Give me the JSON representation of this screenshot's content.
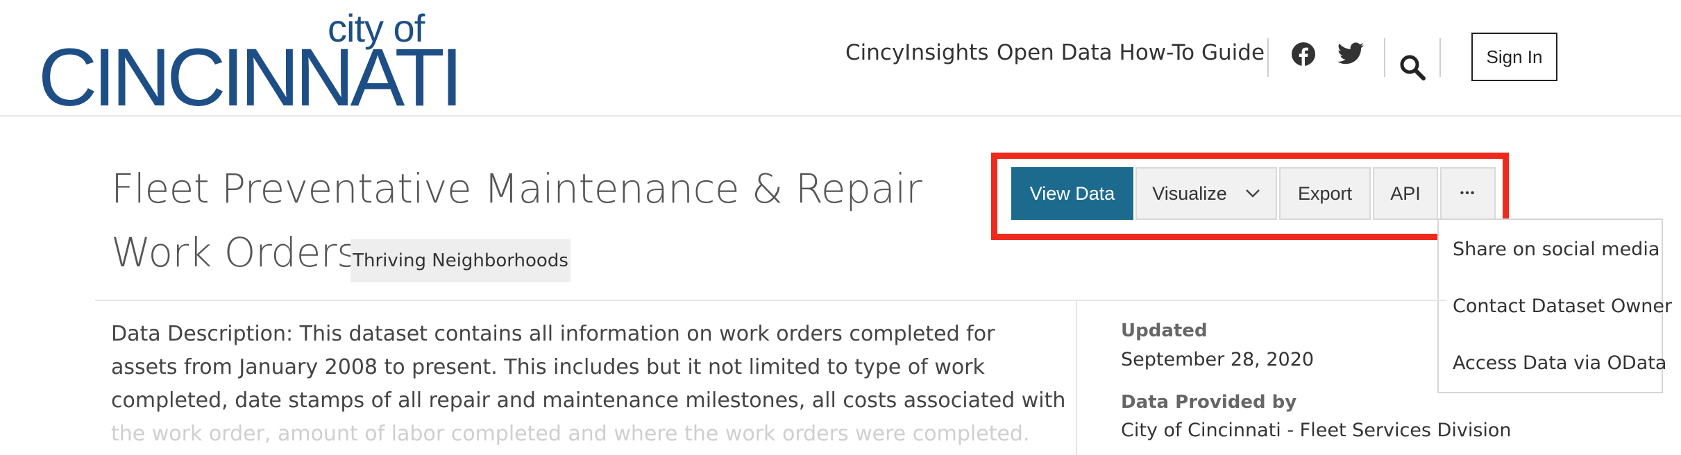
{
  "header": {
    "logo_small": "city of",
    "logo_big": "CINCINNATI",
    "nav": [
      "CincyInsights",
      "Open Data How-To Guide"
    ],
    "sign_in": "Sign In",
    "icons": [
      "facebook-icon",
      "twitter-icon",
      "search-icon"
    ],
    "brand_color": "#1d4e86"
  },
  "dataset": {
    "title": "Fleet Preventative Maintenance & Repair Work Orders",
    "tag": "Thriving Neighborhoods"
  },
  "toolbar": {
    "view_data": "View Data",
    "visualize": "Visualize",
    "export": "Export",
    "api": "API",
    "more": "•••",
    "primary_color": "#1d6a8f",
    "highlight_color": "#ee2a1c"
  },
  "more_menu": {
    "items": [
      "Share on social media",
      "Contact Dataset Owner",
      "Access Data via OData"
    ]
  },
  "description": {
    "lines": [
      "Data Description: This dataset contains all information on work orders completed for",
      "assets from January 2008 to present. This includes but it not limited to type of work",
      "completed, date stamps of all repair and maintenance milestones, all costs associated with",
      "the work order, amount of labor completed and where the work orders were completed."
    ]
  },
  "meta": {
    "updated_label": "Updated",
    "updated_value": "September 28, 2020",
    "provided_label": "Data Provided by",
    "provided_value": "City of Cincinnati - Fleet Services Division"
  }
}
